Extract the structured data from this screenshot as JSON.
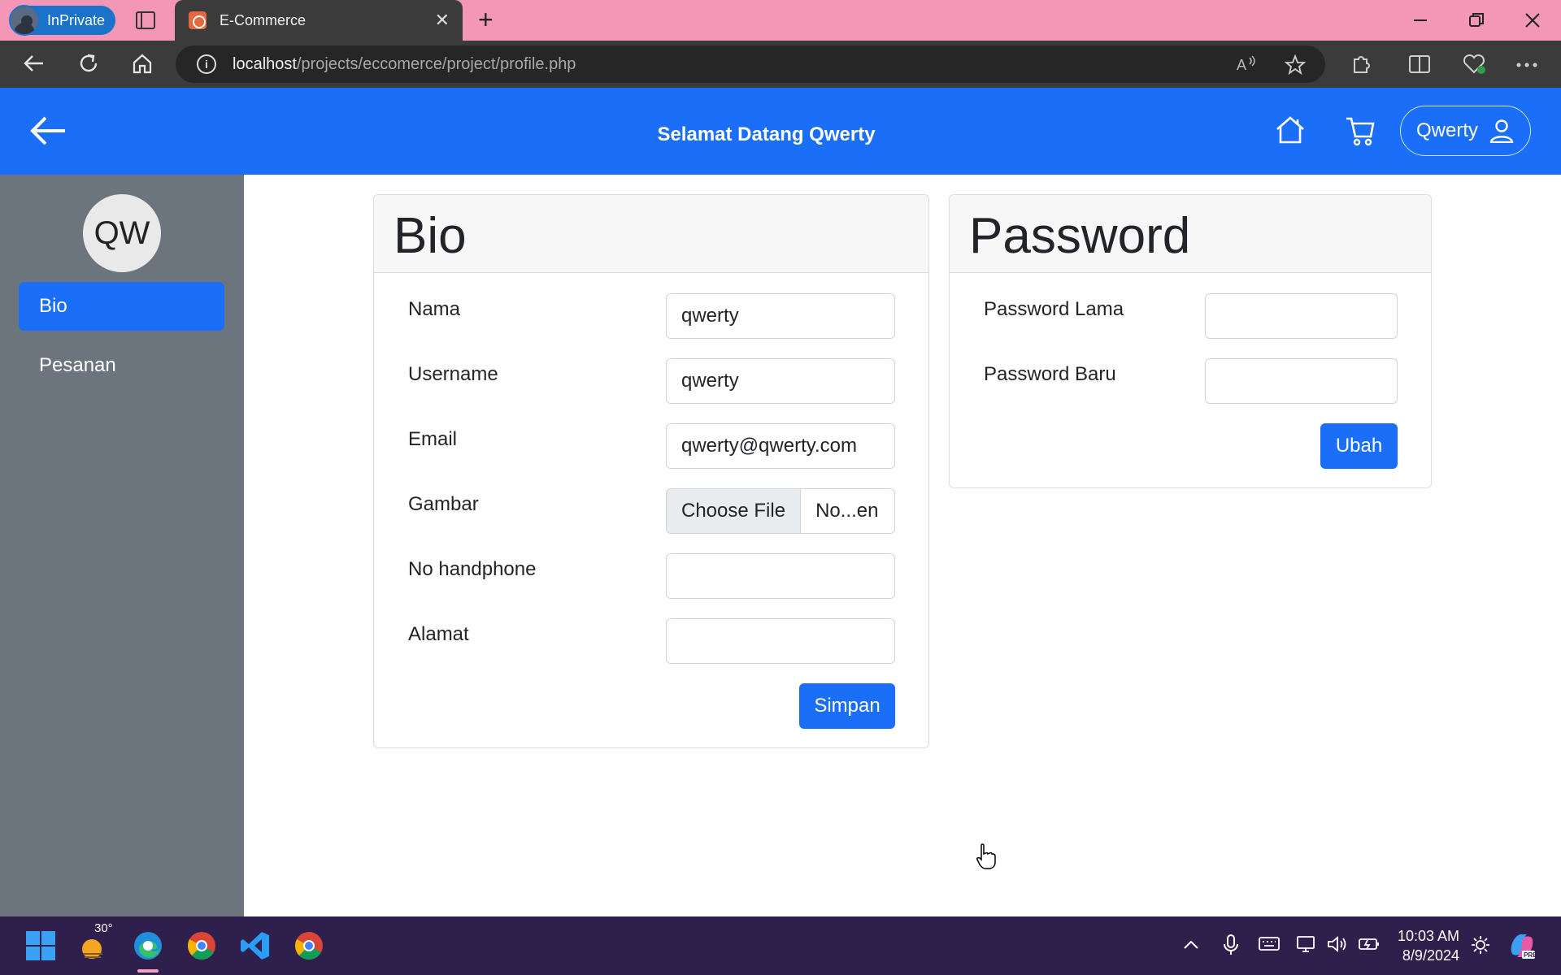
{
  "browser": {
    "profile_label": "InPrivate",
    "tab_title": "E-Commerce",
    "tab_close": "✕",
    "new_tab": "+",
    "url_host": "localhost",
    "url_path": "/projects/eccomerce/project/profile.php"
  },
  "header": {
    "welcome": "Selamat Datang Qwerty",
    "user_name": "Qwerty",
    "accent_color": "#1a6ef7"
  },
  "sidebar": {
    "avatar_initials": "QW",
    "items": [
      {
        "label": "Bio",
        "active": true
      },
      {
        "label": "Pesanan",
        "active": false
      }
    ]
  },
  "bio_card": {
    "title": "Bio",
    "fields": [
      {
        "label": "Nama",
        "value": "qwerty"
      },
      {
        "label": "Username",
        "value": "qwerty"
      },
      {
        "label": "Email",
        "value": "qwerty@qwerty.com"
      },
      {
        "label": "Gambar",
        "file_button": "Choose File",
        "file_status": "No...en"
      },
      {
        "label": "No handphone",
        "value": ""
      },
      {
        "label": "Alamat",
        "value": ""
      }
    ],
    "submit_label": "Simpan"
  },
  "password_card": {
    "title": "Password",
    "fields": [
      {
        "label": "Password Lama",
        "value": ""
      },
      {
        "label": "Password Baru",
        "value": ""
      }
    ],
    "submit_label": "Ubah"
  },
  "taskbar": {
    "weather_temp": "30°",
    "time": "10:03 AM",
    "date": "8/9/2024"
  }
}
